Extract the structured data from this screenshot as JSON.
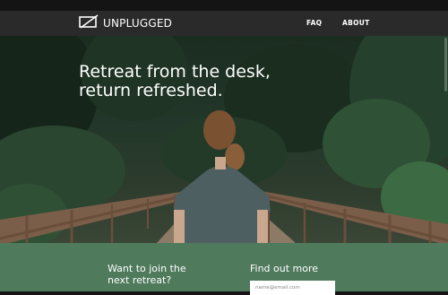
{
  "brand": {
    "name": "UNPLUGGED",
    "icon": "unplugged-logo-icon"
  },
  "nav": {
    "faq": "FAQ",
    "about": "ABOUT"
  },
  "hero": {
    "heading": "Retreat from the desk,\nreturn refreshed."
  },
  "footer": {
    "join_heading": "Want to join the\nnext retreat?",
    "find_heading": "Find out more",
    "email_placeholder": "name@email.com"
  },
  "colors": {
    "navbar": "#2a2a2a",
    "footer": "#4f7a5c",
    "text": "#ffffff"
  }
}
